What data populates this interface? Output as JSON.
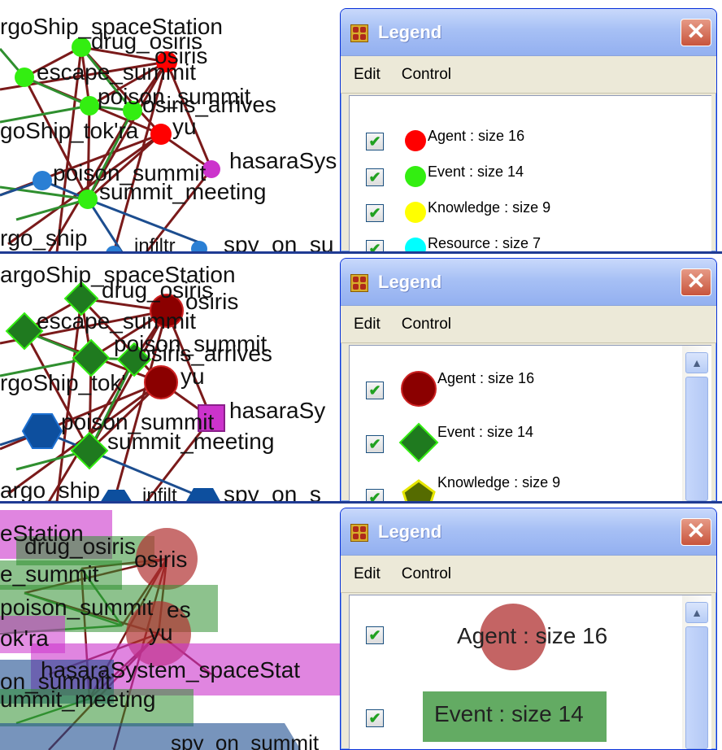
{
  "legend": {
    "title": "Legend",
    "close_glyph": "✕",
    "icon": "legend-grid-icon",
    "menu": [
      "Edit",
      "Control"
    ],
    "checkbox_glyph": "✔",
    "scroll_up_glyph": "▲"
  },
  "panels": [
    {
      "style": "circles",
      "node_labels": {
        "cargoship_spacestation": "rgoShip_spaceStation",
        "drug_osiris": "drug_osiris",
        "osiris": "osiris",
        "escape_summit": "escape_summit",
        "poison_summit": "poison_summit",
        "osiris_arrives": "osiris_arrives",
        "cargoship_tokra": "goShip_tok'ra",
        "yu": "yu",
        "hasarasystem": "hasaraSys",
        "poison_summit_2": "poison_summit",
        "summit_meeting": "summit_meeting",
        "cargo_ship": "rgo_ship",
        "infiltrate": "infiltr",
        "spy_on_summit": "spy_on_su"
      },
      "legend_items": [
        {
          "label": "Agent : size 16",
          "color": "#ff0000",
          "shape": "circle"
        },
        {
          "label": "Event : size 14",
          "color": "#33ee11",
          "shape": "circle"
        },
        {
          "label": "Knowledge : size 9",
          "color": "#ffff00",
          "shape": "circle"
        },
        {
          "label": "Resource : size 7",
          "color": "#00ffff",
          "shape": "circle"
        }
      ]
    },
    {
      "style": "shapes",
      "node_labels": {
        "cargoship_spacestation": "argoShip_spaceStation",
        "drug_osiris": "drug_osiris",
        "osiris": "osiris",
        "escape_summit": "escape_summit",
        "poison_summit": "poison_summit",
        "osiris_arrives": "osiris_arrives",
        "cargoship_tokra": "rgoShip_tok'",
        "yu": "yu",
        "hasarasystem": "hasaraSy",
        "poison_summit_2": "poison_summit",
        "summit_meeting": "summit_meeting",
        "cargo_ship": "argo_ship",
        "infiltrate": "infilt",
        "spy_on_summit": "spy_on_s"
      },
      "legend_items": [
        {
          "label": "Agent : size 16",
          "color": "#8b0000",
          "shape": "circle"
        },
        {
          "label": "Event : size 14",
          "color": "#1f7a1f",
          "shape": "diamond"
        },
        {
          "label": "Knowledge : size 9",
          "color": "#556b00",
          "shape": "pentagon"
        }
      ]
    },
    {
      "style": "boxes",
      "node_labels": {
        "spacestation": "eStation",
        "drug_osiris": "drug_osiris",
        "osiris": "osiris",
        "escape_summit": "e_summit",
        "poison_summit": "poison_summit",
        "osiris_arrives": "es",
        "tokra": "ok'ra",
        "yu": "yu",
        "hasarasystem": "hasaraSystem_spaceStat",
        "poison_summit_2": "on_summit",
        "summit_meeting": "ummit_meeting",
        "spy": "spy_on_summit"
      },
      "legend_items": [
        {
          "label": "Agent : size 16",
          "color": "#b03030",
          "shape": "circle"
        },
        {
          "label": "Event : size 14",
          "color": "#2f8f2f",
          "shape": "box"
        }
      ]
    }
  ],
  "colors": {
    "agent_red": "#ff0000",
    "event_green": "#33ee11",
    "knowledge_yellow": "#ffff00",
    "resource_cyan": "#00ffff",
    "magenta": "#cc33cc",
    "blue": "#2a7fd4",
    "edge_red": "#7a1a1a",
    "edge_green": "#2f8f2f",
    "edge_blue": "#1c4d8f"
  }
}
